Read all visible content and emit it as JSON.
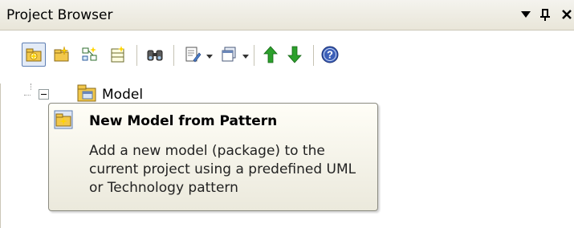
{
  "panel": {
    "title": "Project Browser",
    "controls": [
      {
        "name": "dropdown-icon",
        "glyph": "▼"
      },
      {
        "name": "pin-icon",
        "glyph": "ᴨ"
      },
      {
        "name": "close-icon",
        "glyph": "✕"
      }
    ]
  },
  "toolbar": {
    "buttons": [
      {
        "name": "new-model-from-pattern-button",
        "icon": "new-model-pattern-icon",
        "active": true
      },
      {
        "name": "new-package-button",
        "icon": "new-package-icon"
      },
      {
        "name": "new-diagram-button",
        "icon": "new-diagram-icon"
      },
      {
        "name": "new-element-button",
        "icon": "new-element-icon"
      },
      {
        "name": "find-button",
        "icon": "binoculars-icon"
      },
      {
        "name": "documentation-button",
        "icon": "document-edit-icon",
        "dropdown": true
      },
      {
        "name": "window-button",
        "icon": "window-stack-icon",
        "dropdown": true
      },
      {
        "name": "move-up-button",
        "icon": "arrow-up-icon"
      },
      {
        "name": "move-down-button",
        "icon": "arrow-down-icon"
      },
      {
        "name": "help-button",
        "icon": "help-icon"
      }
    ],
    "colors": {
      "up": "#2ca02c",
      "down": "#2ca02c",
      "help": "#3b5fb8",
      "folder": "#f2c84b"
    }
  },
  "tree": {
    "root": {
      "label": "Model",
      "expanded": true
    }
  },
  "tooltip": {
    "title": "New Model from Pattern",
    "body": "Add a new model (package) to the current project using a predefined UML or Technology pattern"
  }
}
